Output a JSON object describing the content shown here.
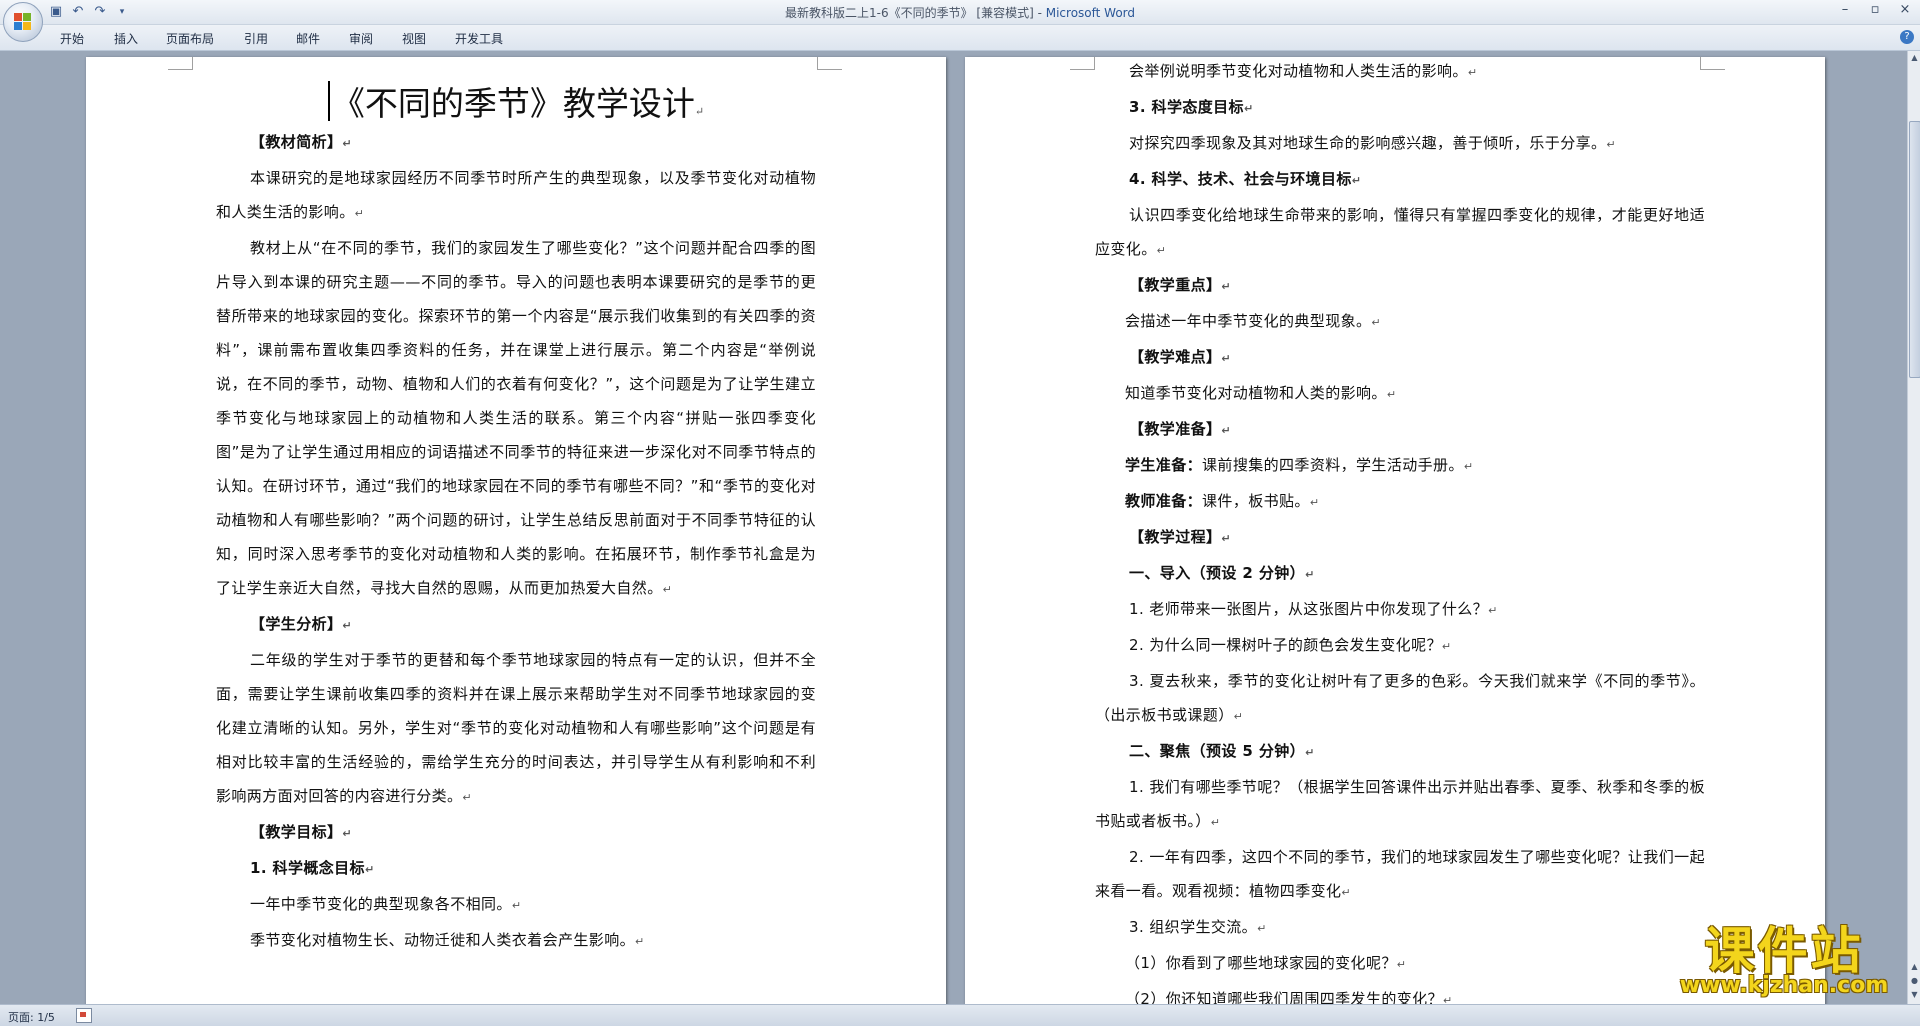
{
  "window": {
    "title_prefix": "最新教科版二上1-6《不同的季节》 [兼容模式] - ",
    "app_name": "Microsoft Word",
    "controls": [
      "–",
      "▫",
      "×"
    ]
  },
  "quick_access": [
    "save-icon",
    "undo-icon",
    "redo-icon",
    "customize-icon"
  ],
  "ribbon": {
    "tabs": [
      "开始",
      "插入",
      "页面布局",
      "引用",
      "邮件",
      "审阅",
      "视图",
      "开发工具"
    ],
    "help": "?"
  },
  "document": {
    "title": "《不同的季节》教学设计",
    "page1": [
      {
        "style": "hi",
        "text": "【教材简析】"
      },
      {
        "style": "indent",
        "text": "本课研究的是地球家园经历不同季节时所产生的典型现象，以及季节变化对动植物和人类生活的影响。"
      },
      {
        "style": "indent",
        "text": "教材上从“在不同的季节，我们的家园发生了哪些变化？”这个问题并配合四季的图片导入到本课的研究主题——不同的季节。导入的问题也表明本课要研究的是季节的更替所带来的地球家园的变化。探索环节的第一个内容是“展示我们收集到的有关四季的资料”，课前需布置收集四季资料的任务，并在课堂上进行展示。第二个内容是“举例说说，在不同的季节，动物、植物和人们的衣着有何变化？”，这个问题是为了让学生建立季节变化与地球家园上的动植物和人类生活的联系。第三个内容“拼贴一张四季变化图”是为了让学生通过用相应的词语描述不同季节的特征来进一步深化对不同季节特点的认知。在研讨环节，通过“我们的地球家园在不同的季节有哪些不同？”和“季节的变化对动植物和人有哪些影响？”两个问题的研讨，让学生总结反思前面对于不同季节特征的认知，同时深入思考季节的变化对动植物和人类的影响。在拓展环节，制作季节礼盒是为了让学生亲近大自然，寻找大自然的恩赐，从而更加热爱大自然。"
      },
      {
        "style": "hi",
        "text": "【学生分析】"
      },
      {
        "style": "indent",
        "text": "二年级的学生对于季节的更替和每个季节地球家园的特点有一定的认识，但并不全面，需要让学生课前收集四季的资料并在课上展示来帮助学生对不同季节地球家园的变化建立清晰的认知。另外，学生对“季节的变化对动植物和人有哪些影响”这个问题是有相对比较丰富的生活经验的，需给学生充分的时间表达，并引导学生从有利影响和不利影响两方面对回答的内容进行分类。"
      },
      {
        "style": "hi",
        "text": "【教学目标】"
      },
      {
        "style": "hi",
        "text": "1. 科学概念目标"
      },
      {
        "style": "indent",
        "text": "一年中季节变化的典型现象各不相同。"
      },
      {
        "style": "indent",
        "text": "季节变化对植物生长、动物迁徙和人类衣着会产生影响。"
      }
    ],
    "page2": [
      {
        "style": "indent",
        "text": "会举例说明季节变化对动植物和人类生活的影响。"
      },
      {
        "style": "hi",
        "text": "3. 科学态度目标"
      },
      {
        "style": "indent",
        "text": "对探究四季现象及其对地球生命的影响感兴趣，善于倾听，乐于分享。"
      },
      {
        "style": "hi",
        "text": "4. 科学、技术、社会与环境目标"
      },
      {
        "style": "indent",
        "text": "认识四季变化给地球生命带来的影响，懂得只有掌握四季变化的规律，才能更好地适应变化。"
      },
      {
        "style": "hi",
        "text": "【教学重点】"
      },
      {
        "style": "lead",
        "text": "会描述一年中季节变化的典型现象。"
      },
      {
        "style": "hi",
        "text": "【教学难点】"
      },
      {
        "style": "lead",
        "text": "知道季节变化对动植物和人类的影响。"
      },
      {
        "style": "hi",
        "text": "【教学准备】"
      },
      {
        "style": "lead",
        "label": "学生准备：",
        "text": "课前搜集的四季资料，学生活动手册。"
      },
      {
        "style": "lead",
        "label": "教师准备：",
        "text": "课件，板书贴。"
      },
      {
        "style": "hi",
        "text": "【教学过程】"
      },
      {
        "style": "hi",
        "text": "一、导入（预设 2 分钟）"
      },
      {
        "style": "indent",
        "text": "1. 老师带来一张图片，从这张图片中你发现了什么？"
      },
      {
        "style": "indent",
        "text": "2. 为什么同一棵树叶子的颜色会发生变化呢？"
      },
      {
        "style": "indent",
        "text": "3. 夏去秋来，季节的变化让树叶有了更多的色彩。今天我们就来学《不同的季节》。（出示板书或课题）"
      },
      {
        "style": "hi",
        "text": "二、聚焦（预设 5 分钟）"
      },
      {
        "style": "indent",
        "text": "1. 我们有哪些季节呢？（根据学生回答课件出示并贴出春季、夏季、秋季和冬季的板书贴或者板书。）"
      },
      {
        "style": "indent",
        "text": "2. 一年有四季，这四个不同的季节，我们的地球家园发生了哪些变化呢？让我们一起来看一看。观看视频：植物四季变化"
      },
      {
        "style": "indent",
        "text": "3. 组织学生交流。"
      },
      {
        "style": "lead",
        "text": "（1）你看到了哪些地球家园的变化呢？"
      },
      {
        "style": "lead",
        "text": "（2）你还知道哪些我们周围四季发生的变化？"
      }
    ]
  },
  "statusbar": {
    "page": "页面: 1/5"
  },
  "watermark": {
    "logo": "课件站",
    "url": "www.kjzhan.com"
  }
}
